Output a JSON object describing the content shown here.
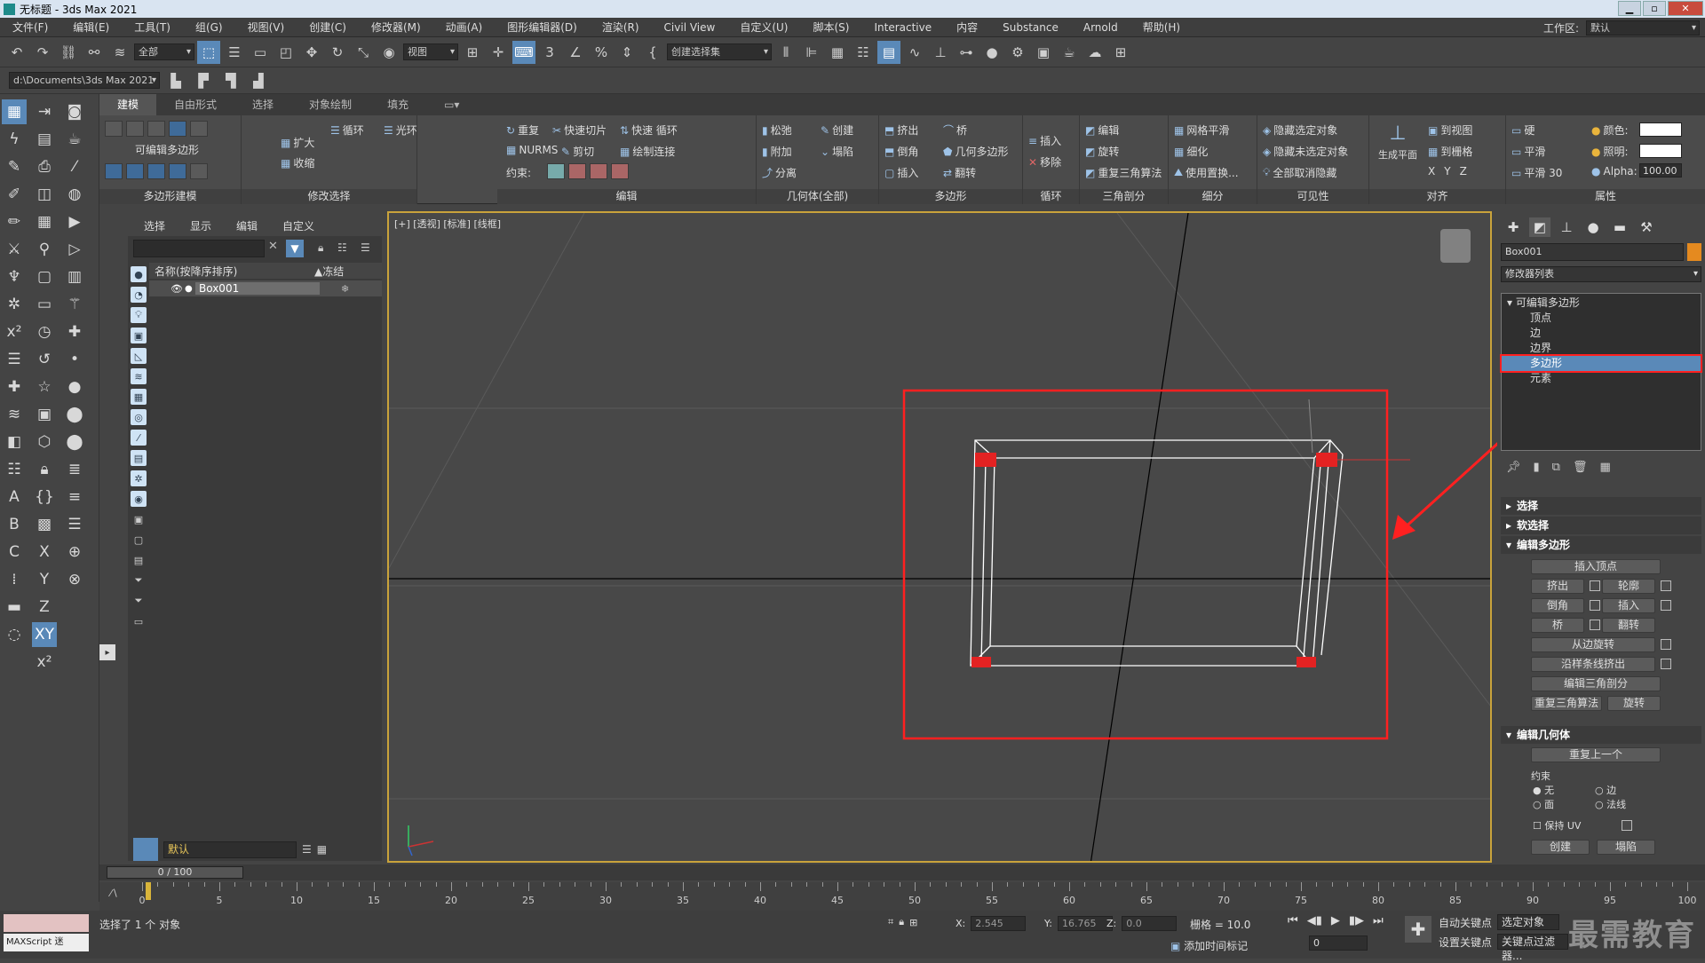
{
  "window": {
    "title": "无标题 - 3ds Max 2021"
  },
  "menu": {
    "items": [
      "文件(F)",
      "编辑(E)",
      "工具(T)",
      "组(G)",
      "视图(V)",
      "创建(C)",
      "修改器(M)",
      "动画(A)",
      "图形编辑器(D)",
      "渲染(R)",
      "Civil View",
      "自定义(U)",
      "脚本(S)",
      "Interactive",
      "内容",
      "Substance",
      "Arnold",
      "帮助(H)"
    ],
    "workspace_label": "工作区:",
    "workspace_value": "默认"
  },
  "toolbar": {
    "filter": "全部",
    "ref_coord": "视图",
    "selection_set": "创建选择集",
    "project_path": "d:\\Documents\\3ds Max 2021"
  },
  "ribbon": {
    "tabs": [
      "建模",
      "自由形式",
      "选择",
      "对象绘制",
      "填充"
    ],
    "groups": [
      "多边形建模",
      "修改选择",
      "编辑",
      "几何体(全部)",
      "多边形",
      "循环",
      "三角剖分",
      "细分",
      "可见性",
      "对齐",
      "属性"
    ],
    "poly_label": "可编辑多边形",
    "modsel": [
      "扩大",
      "收缩",
      "循环",
      "光环"
    ],
    "edit": [
      "重复",
      "快速切片",
      "快速 循环",
      "NURMS",
      "剪切",
      "绘制连接",
      "约束:"
    ],
    "geom": [
      "松弛",
      "创建",
      "附加",
      "塌陷",
      "分离"
    ],
    "polygon": [
      "挤出",
      "桥",
      "倒角",
      "几何多边形",
      "插入",
      "翻转"
    ],
    "loop": [
      "插入",
      "移除"
    ],
    "tri": [
      "编辑",
      "旋转",
      "重复三角算法"
    ],
    "subdiv": [
      "网格平滑",
      "细化",
      "使用置换..."
    ],
    "vis": [
      "隐藏选定对象",
      "隐藏未选定对象",
      "全部取消隐藏"
    ],
    "align_gen": "生成平面",
    "align": [
      "到视图",
      "到栅格",
      "X",
      "Y",
      "Z"
    ],
    "smooth": [
      "硬",
      "平滑",
      "平滑 30"
    ],
    "props": {
      "color": "颜色:",
      "illum": "照明:",
      "alpha": "Alpha:",
      "alpha_value": "100.00"
    }
  },
  "scene_explorer": {
    "tabs": [
      "选择",
      "显示",
      "编辑",
      "自定义"
    ],
    "col_name": "名称(按降序排序)",
    "col_freeze": "▲冻结",
    "object": "Box001",
    "layer": "默认"
  },
  "viewport": {
    "label": "[+] [透视] [标准] [线框]"
  },
  "command_panel": {
    "object_name": "Box001",
    "modifier_list": "修改器列表",
    "stack": [
      "可编辑多边形",
      "顶点",
      "边",
      "边界",
      "多边形",
      "元素"
    ],
    "rollouts": [
      "选择",
      "软选择",
      "编辑多边形",
      "编辑几何体"
    ],
    "edit_poly_buttons": [
      "插入顶点",
      "挤出",
      "轮廓",
      "倒角",
      "插入",
      "桥",
      "翻转",
      "从边旋转",
      "沿样条线挤出",
      "编辑三角剖分",
      "重复三角算法",
      "旋转"
    ],
    "edit_geom": {
      "repeat_last": "重复上一个",
      "constraint": "约束",
      "none": "无",
      "edge": "边",
      "face": "面",
      "normal": "法线",
      "keep_uv": "保持 UV",
      "create": "创建",
      "collapse": "塌陷"
    }
  },
  "timeline": {
    "slider": "0 / 100",
    "ticks": [
      0,
      5,
      10,
      15,
      20,
      25,
      30,
      35,
      40,
      45,
      50,
      55,
      60,
      65,
      70,
      75,
      80,
      85,
      90,
      95,
      100
    ]
  },
  "status": {
    "maxscript": "MAXScript 迷",
    "selected": "选择了 1 个 对象",
    "x_label": "X:",
    "x": "2.545",
    "y_label": "Y:",
    "y": "16.765",
    "z_label": "Z:",
    "z": "0.0",
    "grid": "栅格 = 10.0",
    "add_time_tag": "添加时间标记",
    "auto_key": "自动关键点",
    "set_key": "设置关键点",
    "selected_obj": "选定对象",
    "key_filter": "关键点过滤器...",
    "frame": "0"
  },
  "watermark": "最需教育",
  "colors": {
    "accent": "#5a89b8",
    "highlight": "#ff2020",
    "viewport_border": "#c9a33b"
  }
}
